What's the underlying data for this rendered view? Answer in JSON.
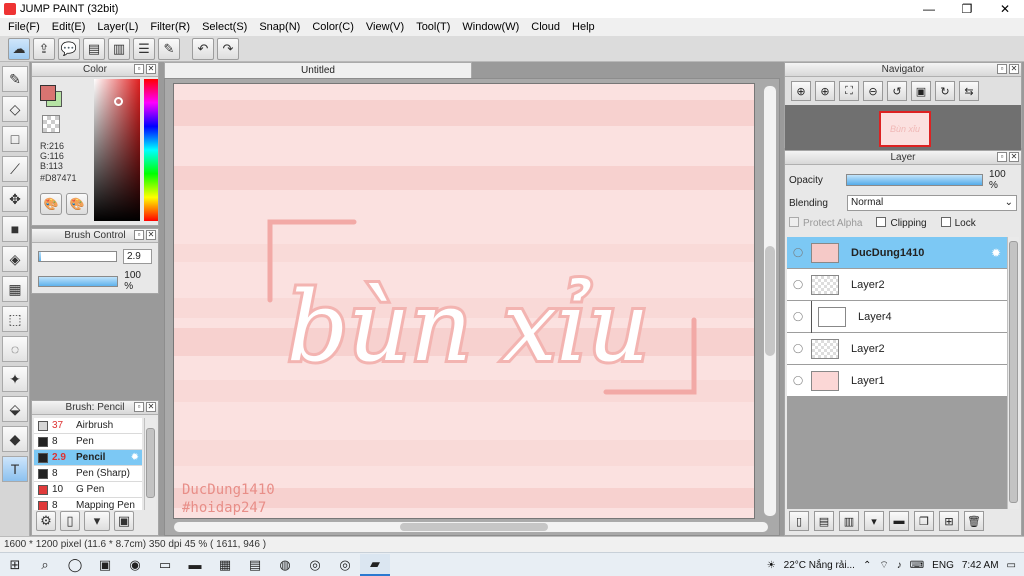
{
  "window": {
    "title": "JUMP PAINT (32bit)",
    "min": "—",
    "max": "❐",
    "close": "✕"
  },
  "menu": [
    "File(F)",
    "Edit(E)",
    "Layer(L)",
    "Filter(R)",
    "Select(S)",
    "Snap(N)",
    "Color(C)",
    "View(V)",
    "Tool(T)",
    "Window(W)",
    "Cloud",
    "Help"
  ],
  "color_panel": {
    "title": "Color",
    "r": "R:216",
    "g": "G:116",
    "b": "B:113",
    "hex": "#D87471",
    "fg_color": "#d87471",
    "bg_color": "#b6e3a4"
  },
  "brush_control": {
    "title": "Brush Control",
    "size": "2.9",
    "opacity": "100 %",
    "size_level": 0.02,
    "opacity_level": 1.0
  },
  "brush_panel": {
    "title": "Brush: Pencil",
    "items": [
      {
        "size": "37",
        "name": "Airbrush",
        "color": "#d6d6d6"
      },
      {
        "size": "8",
        "name": "Pen",
        "color": "#222222"
      },
      {
        "size": "2.9",
        "name": "Pencil",
        "color": "#222222"
      },
      {
        "size": "8",
        "name": "Pen (Sharp)",
        "color": "#222222"
      },
      {
        "size": "10",
        "name": "G Pen",
        "color": "#e03a3a"
      },
      {
        "size": "8",
        "name": "Mapping Pen",
        "color": "#e03a3a"
      }
    ]
  },
  "document": {
    "tab": "Untitled",
    "artwork_text": "bùn xỉu",
    "watermark_line1": "DucDung1410",
    "watermark_line2": "#hoidap247"
  },
  "navigator": {
    "title": "Navigator",
    "thumb_text": "Bùn xỉu"
  },
  "layer_panel": {
    "title": "Layer",
    "opacity_label": "Opacity",
    "opacity_value": "100 %",
    "blending_label": "Blending",
    "blending_value": "Normal",
    "protect_alpha": "Protect Alpha",
    "clipping": "Clipping",
    "lock": "Lock",
    "layers": [
      {
        "name": "DucDung1410",
        "selected": true
      },
      {
        "name": "Layer2"
      },
      {
        "name": "Layer4"
      },
      {
        "name": "Layer2"
      },
      {
        "name": "Layer1"
      }
    ]
  },
  "status": "1600 * 1200 pixel   (11.6 * 8.7cm)   350 dpi   45 %   ( 1611, 946 )",
  "taskbar": {
    "weather": "22°C  Nắng rải...",
    "lang": "ENG",
    "time": "7:42 AM"
  }
}
